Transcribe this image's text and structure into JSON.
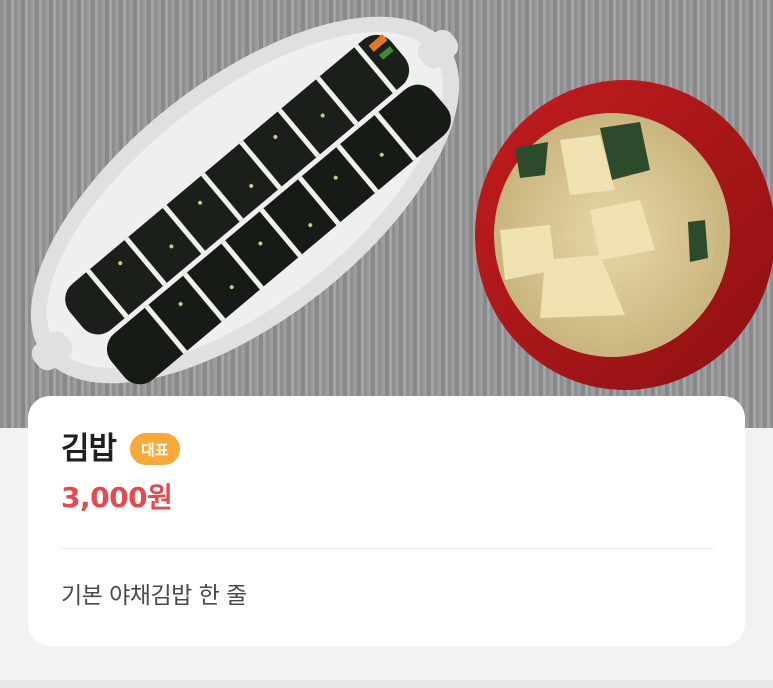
{
  "menu_item": {
    "image_alt": "김밥 photo",
    "name": "김밥",
    "badge": "대표",
    "price": "3,000원",
    "description": "기본 야채김밥 한 줄"
  },
  "colors": {
    "price": "#e6484e",
    "badge_bg": "#f9a93a",
    "card_bg": "#ffffff",
    "page_bg": "#f2f2f2"
  }
}
